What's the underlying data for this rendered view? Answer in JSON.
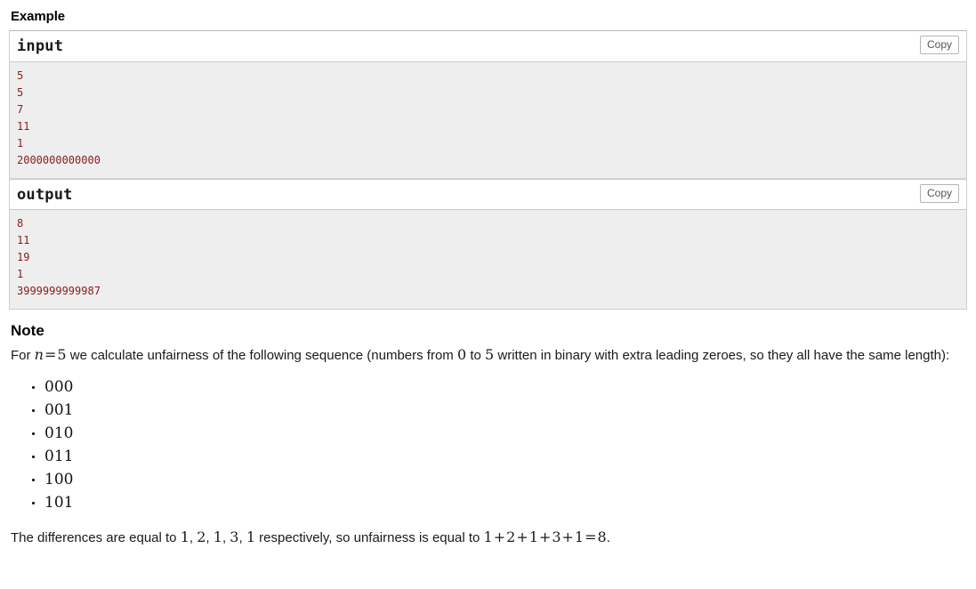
{
  "example": {
    "heading": "Example",
    "blocks": [
      {
        "title": "input",
        "copy_label": "Copy",
        "data": "5\n5\n7\n11\n1\n2000000000000"
      },
      {
        "title": "output",
        "copy_label": "Copy",
        "data": "8\n11\n19\n1\n3999999999987"
      }
    ]
  },
  "note": {
    "heading": "Note",
    "para1_a": "For ",
    "para1_n": "n",
    "para1_eq": "=",
    "para1_5": "5",
    "para1_b": " we calculate unfairness of the following sequence (numbers from ",
    "para1_0": "0",
    "para1_c": " to ",
    "para1_5b": "5",
    "para1_d": " written in binary with extra leading zeroes, so they all have the same length):",
    "list": [
      "000",
      "001",
      "010",
      "011",
      "100",
      "101"
    ],
    "final_a": "The differences are equal to ",
    "final_d1": "1",
    "final_c1": ", ",
    "final_d2": "2",
    "final_c2": ", ",
    "final_d3": "1",
    "final_c3": ", ",
    "final_d4": "3",
    "final_c4": ", ",
    "final_d5": "1",
    "final_b": " respectively, so unfairness is equal to ",
    "eq_1": "1",
    "eq_p1": "+",
    "eq_2": "2",
    "eq_p2": "+",
    "eq_3": "1",
    "eq_p3": "+",
    "eq_4": "3",
    "eq_p4": "+",
    "eq_5": "1",
    "eq_eqsign": "=",
    "eq_result": "8",
    "final_period": "."
  },
  "colors": {
    "sample_text": "#8b1a1a",
    "sample_bg": "#eeeeee",
    "border": "#cfcfcf"
  }
}
